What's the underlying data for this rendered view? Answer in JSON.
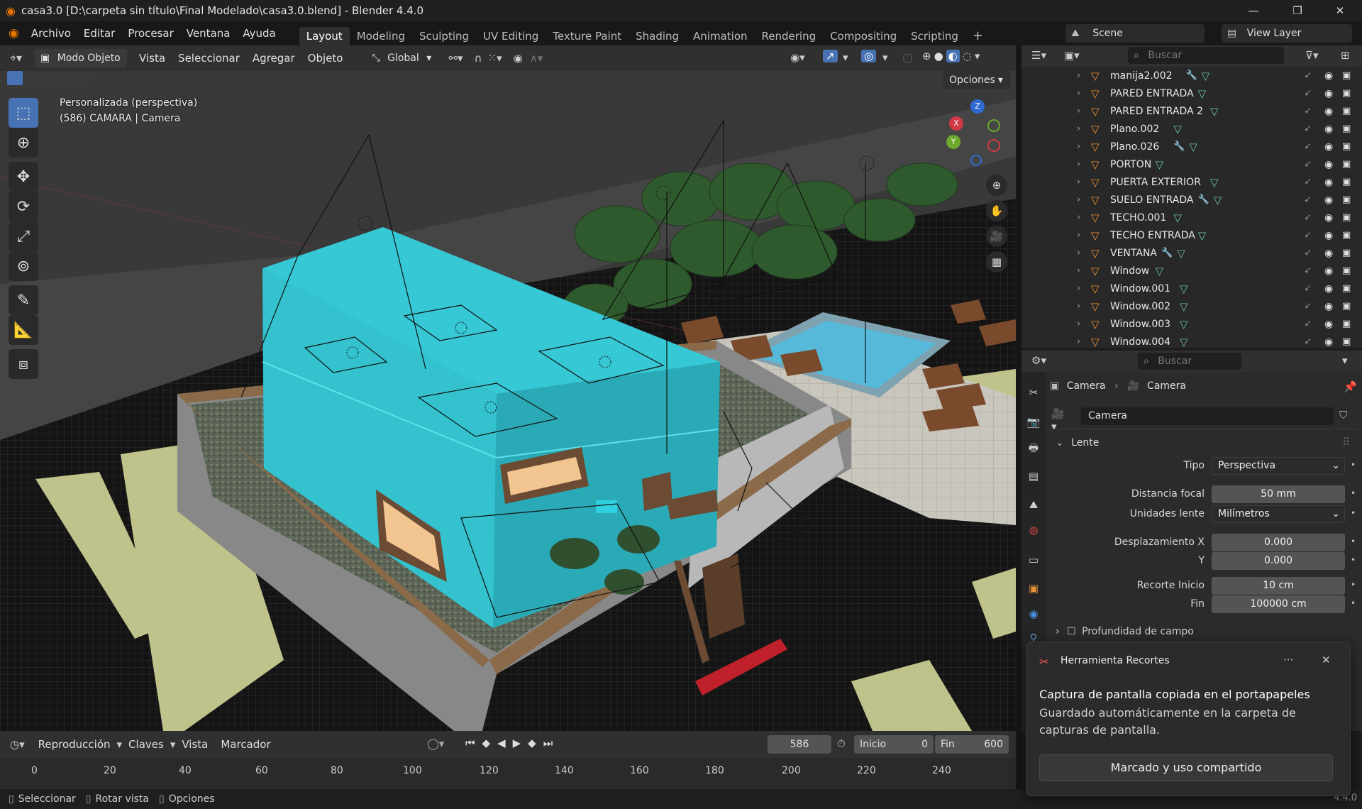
{
  "window": {
    "title": "casa3.0 [D:\\carpeta sin título\\Final Modelado\\casa3.0.blend] - Blender 4.4.0",
    "min": "—",
    "max": "❐",
    "close": "✕"
  },
  "menu": [
    "Archivo",
    "Editar",
    "Procesar",
    "Ventana",
    "Ayuda"
  ],
  "workspaces": [
    "Layout",
    "Modeling",
    "Sculpting",
    "UV Editing",
    "Texture Paint",
    "Shading",
    "Animation",
    "Rendering",
    "Compositing",
    "Scripting"
  ],
  "add_workspace": "+",
  "scene": {
    "name": "Scene",
    "view_layer": "View Layer"
  },
  "viewport_header": {
    "mode": "Modo Objeto",
    "menus": [
      "Vista",
      "Seleccionar",
      "Agregar",
      "Objeto"
    ],
    "orientation": "Global",
    "options": "Opciones"
  },
  "viewport": {
    "view_name": "Personalizada (perspectiva)",
    "object_info": "(586) CAMARA | Camera",
    "gizmo": {
      "x": "X",
      "y": "Y",
      "z": "Z"
    }
  },
  "outliner": {
    "search_placeholder": "Buscar",
    "items": [
      {
        "name": "manija2.002",
        "modifier": true
      },
      {
        "name": "PARED ENTRADA",
        "modifier": false
      },
      {
        "name": "PARED ENTRADA 2",
        "modifier": false
      },
      {
        "name": "Plano.002",
        "modifier": false
      },
      {
        "name": "Plano.026",
        "modifier": true
      },
      {
        "name": "PORTON",
        "modifier": false
      },
      {
        "name": "PUERTA EXTERIOR",
        "modifier": false
      },
      {
        "name": "SUELO ENTRADA",
        "modifier": true
      },
      {
        "name": "TECHO.001",
        "modifier": false
      },
      {
        "name": "TECHO ENTRADA",
        "modifier": false
      },
      {
        "name": "VENTANA",
        "modifier": true
      },
      {
        "name": "Window",
        "modifier": false
      },
      {
        "name": "Window.001",
        "modifier": false
      },
      {
        "name": "Window.002",
        "modifier": false
      },
      {
        "name": "Window.003",
        "modifier": false
      },
      {
        "name": "Window.004",
        "modifier": false
      }
    ]
  },
  "properties": {
    "search_placeholder": "Buscar",
    "breadcrumb": [
      "Camera",
      "Camera"
    ],
    "datablock": "Camera",
    "panel_lens": "Lente",
    "tipo_label": "Tipo",
    "tipo_value": "Perspectiva",
    "focal_label": "Distancia focal",
    "focal_value": "50 mm",
    "units_label": "Unidades lente",
    "units_value": "Milímetros",
    "shift_x_label": "Desplazamiento X",
    "shift_x_value": "0.000",
    "shift_y_label": "Y",
    "shift_y_value": "0.000",
    "clip_label": "Recorte  Inicio",
    "clip_start_value": "10 cm",
    "clip_end_label": "Fin",
    "clip_end_value": "100000 cm",
    "panel_dof": "Profundidad de campo"
  },
  "timeline": {
    "menus": [
      "Reproducción",
      "Claves",
      "Vista",
      "Marcador"
    ],
    "current_frame": "586",
    "start_label": "Inicio",
    "start_value": "0",
    "end_label": "Fin",
    "end_value": "600",
    "ruler": [
      "0",
      "20",
      "40",
      "60",
      "80",
      "100",
      "120",
      "140",
      "160",
      "180",
      "200",
      "220",
      "240"
    ]
  },
  "statusbar": {
    "select": "Seleccionar",
    "rotate": "Rotar vista",
    "options": "Opciones",
    "version": "4.4.0"
  },
  "toast": {
    "app": "Herramienta Recortes",
    "more": "···",
    "close": "✕",
    "heading": "Captura de pantalla copiada en el portapapeles",
    "body": "Guardado automáticamente en la carpeta de capturas de pantalla.",
    "button": "Marcado y uso compartido"
  },
  "colors": {
    "accent": "#4772b3",
    "house": "#36c8d4",
    "object_orange": "#e99135",
    "mesh_green": "#69c0a2"
  }
}
